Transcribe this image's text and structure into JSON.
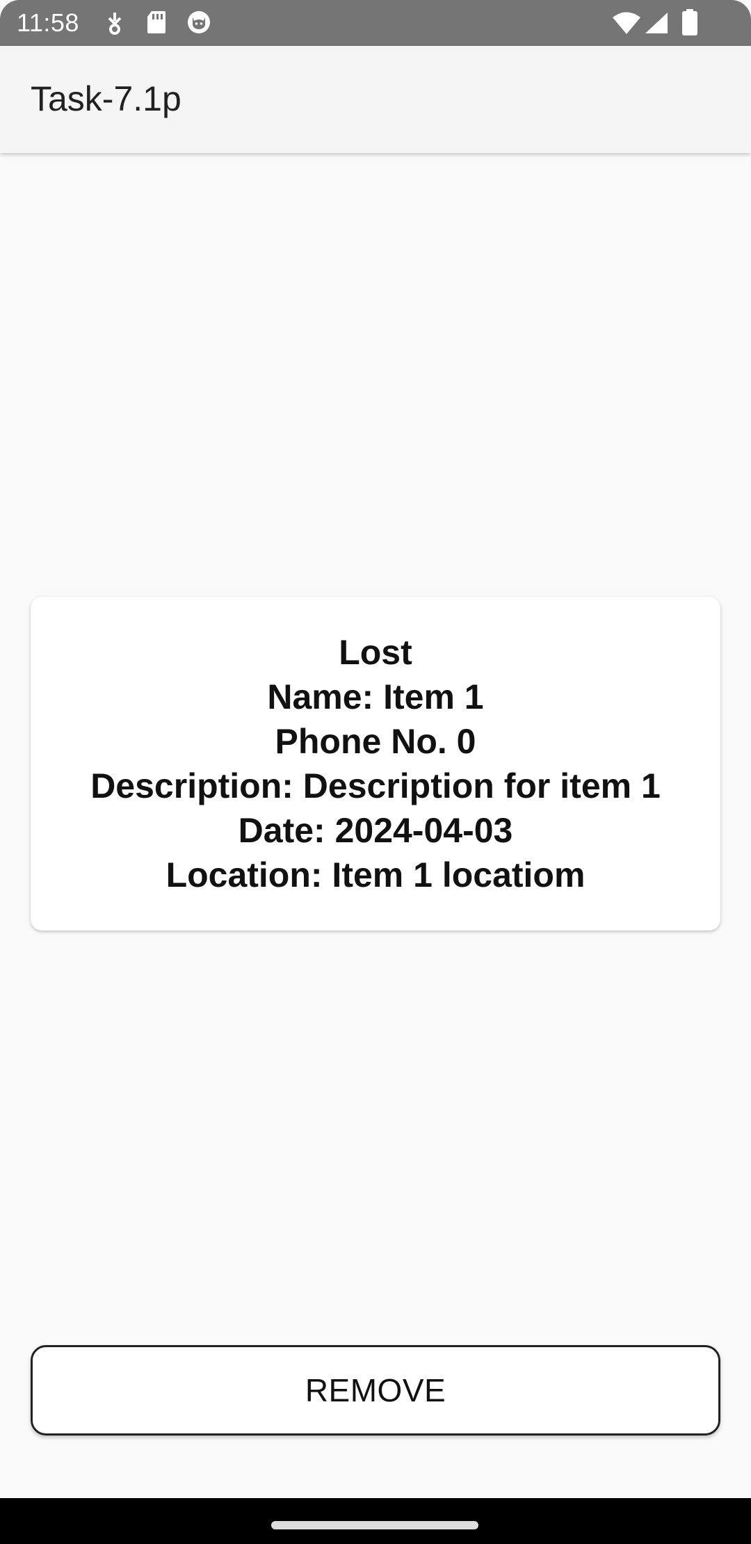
{
  "status_bar": {
    "time": "11:58",
    "left_icons": [
      "usb-debug-icon",
      "sd-card-icon",
      "cat-face-icon"
    ],
    "right_icons": [
      "wifi-icon",
      "cell-signal-icon",
      "battery-icon"
    ]
  },
  "app_bar": {
    "title": "Task-7.1p"
  },
  "item_card": {
    "status": "Lost",
    "name": "Name: Item 1",
    "phone": "Phone No. 0",
    "description": "Description: Description for item 1",
    "date": "Date: 2024-04-03",
    "location": "Location: Item 1 locatiom"
  },
  "actions": {
    "remove_label": "REMOVE"
  },
  "colors": {
    "status_bar": "#757575",
    "app_bar": "#f5f5f5",
    "background": "#fafafa",
    "card": "#ffffff",
    "nav_bar": "#000000"
  }
}
